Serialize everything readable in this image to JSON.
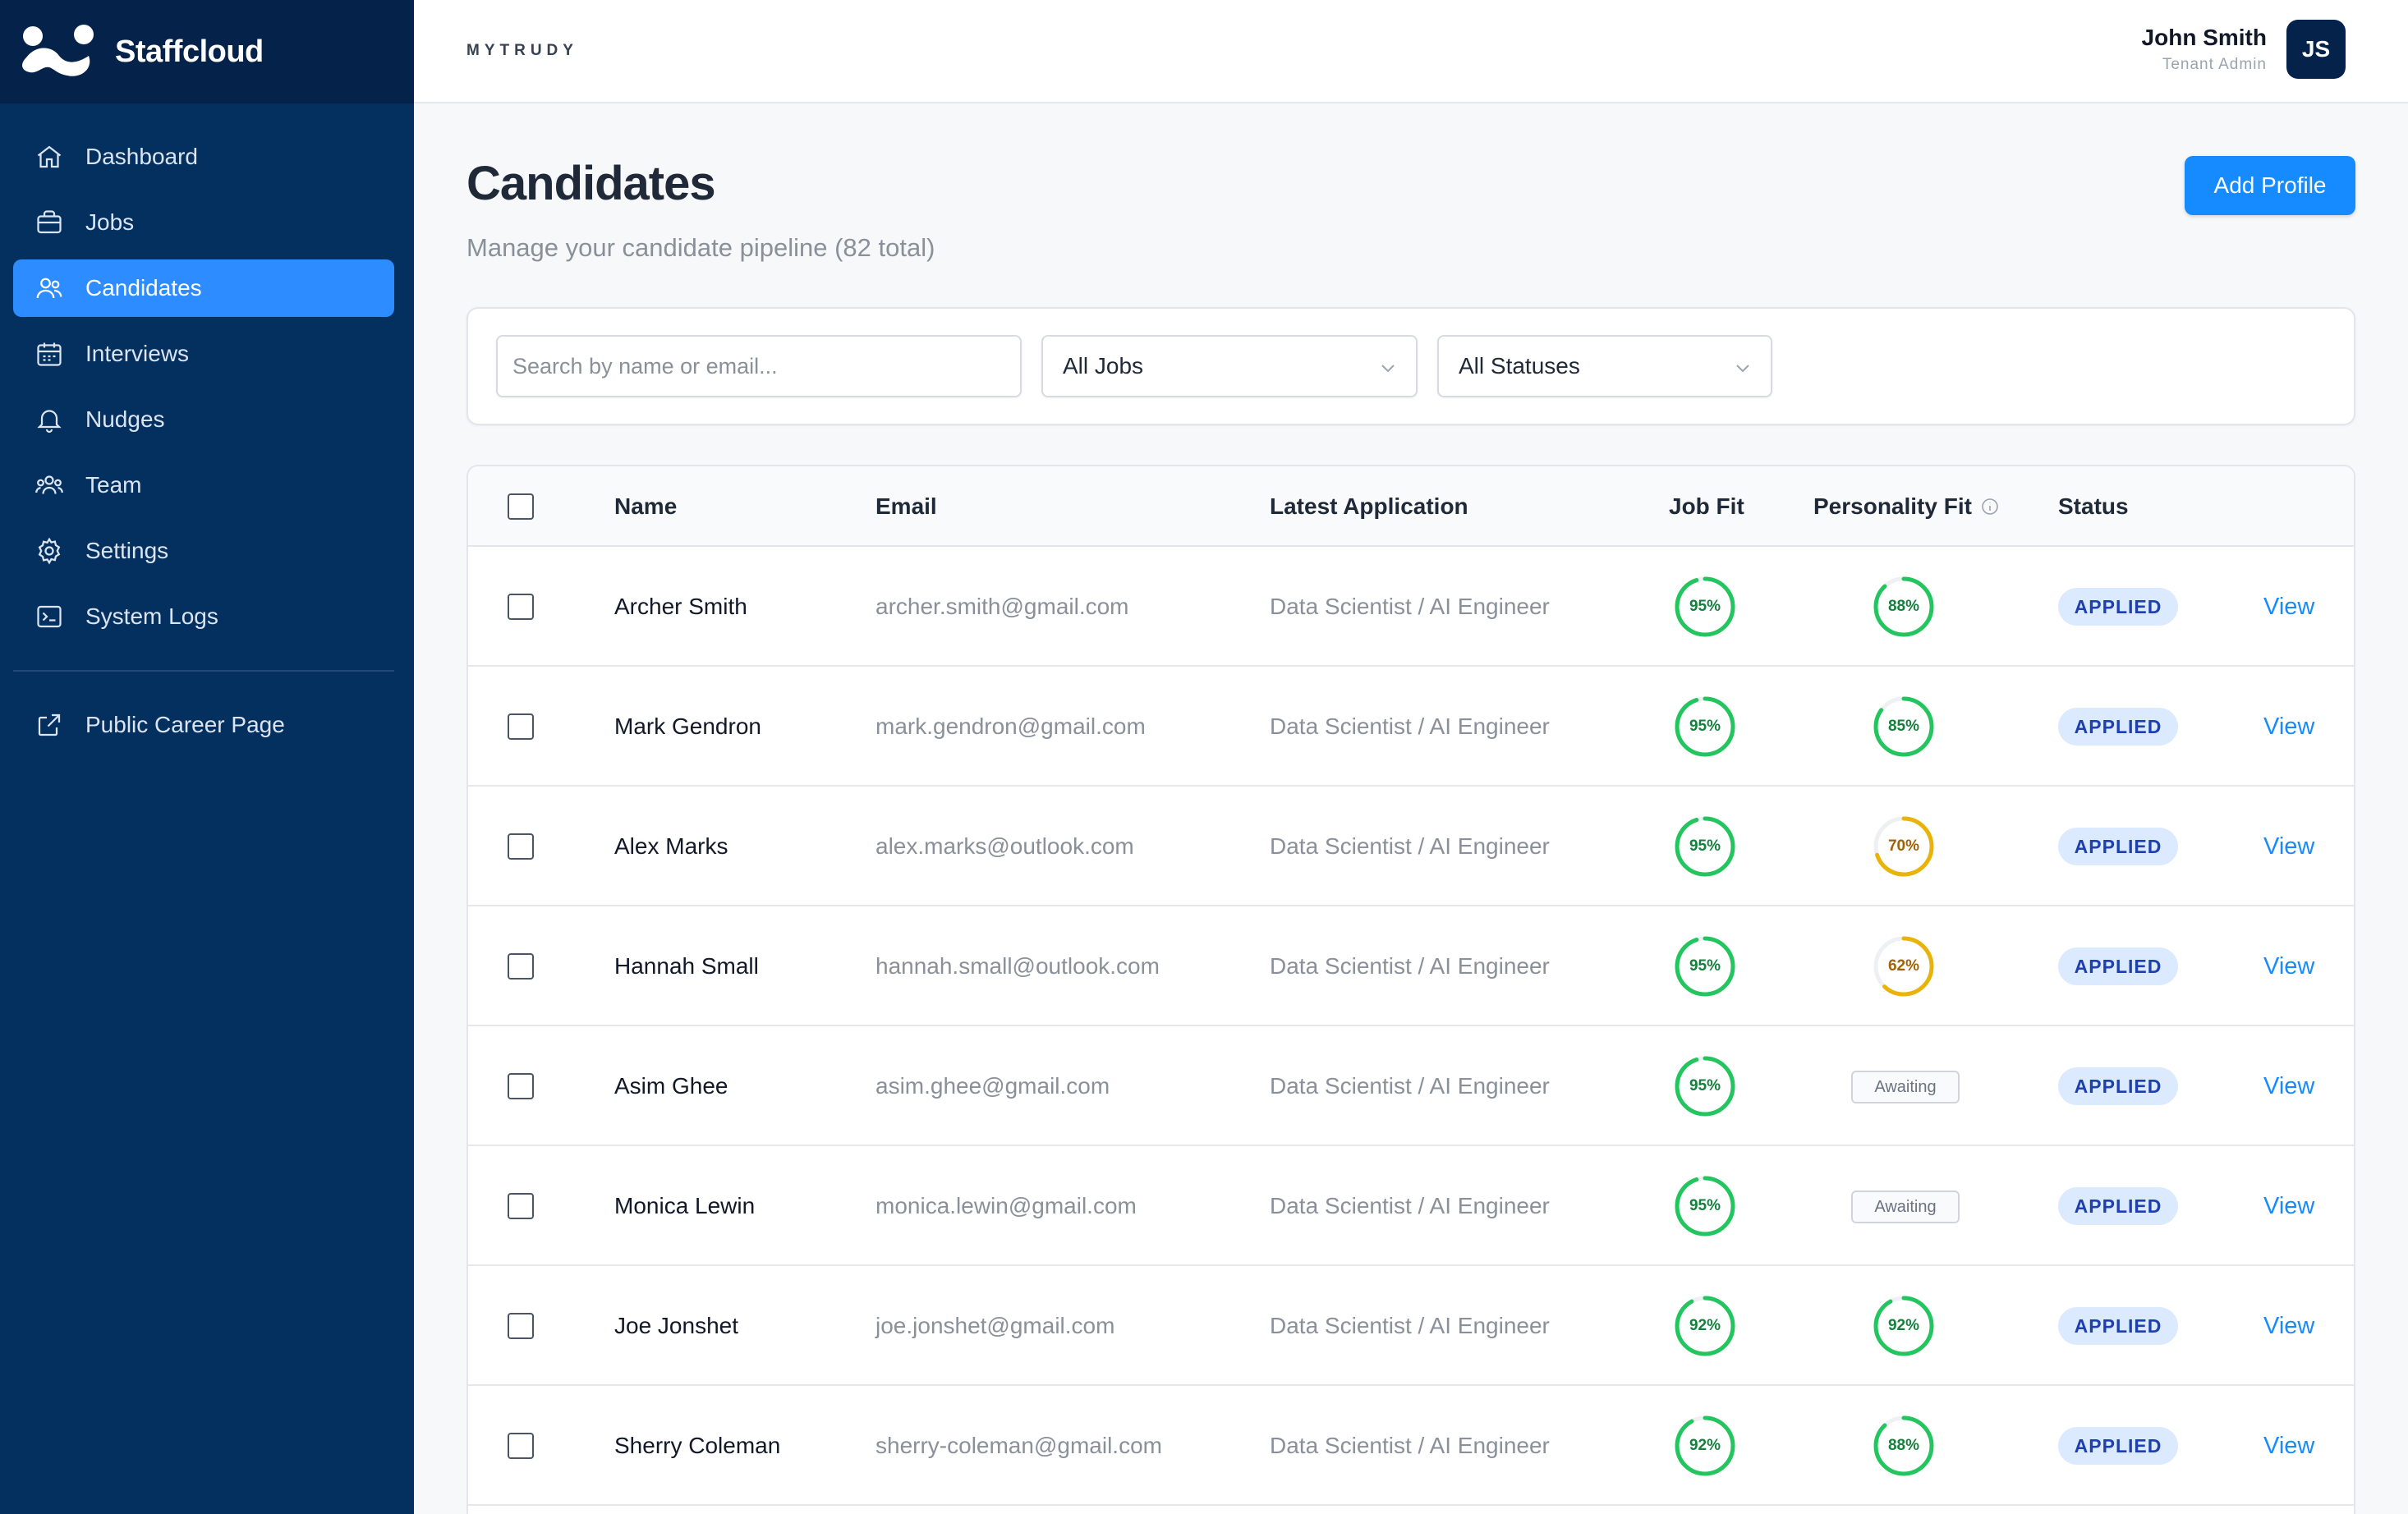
{
  "brand": {
    "name": "Staffcloud"
  },
  "sidebar": {
    "items": [
      {
        "label": "Dashboard",
        "icon": "home-icon"
      },
      {
        "label": "Jobs",
        "icon": "briefcase-icon"
      },
      {
        "label": "Candidates",
        "icon": "users-icon",
        "active": true
      },
      {
        "label": "Interviews",
        "icon": "calendar-icon"
      },
      {
        "label": "Nudges",
        "icon": "bell-icon"
      },
      {
        "label": "Team",
        "icon": "team-icon"
      },
      {
        "label": "Settings",
        "icon": "gear-icon"
      },
      {
        "label": "System Logs",
        "icon": "terminal-icon"
      }
    ],
    "footer_link": {
      "label": "Public Career Page",
      "icon": "external-link-icon"
    }
  },
  "header": {
    "tenant": "MYTRUDY",
    "user_name": "John Smith",
    "user_role": "Tenant Admin",
    "avatar_initials": "JS"
  },
  "page": {
    "title": "Candidates",
    "subtitle": "Manage your candidate pipeline (82 total)",
    "add_button": "Add Profile"
  },
  "filters": {
    "search_placeholder": "Search by name or email...",
    "jobs_selected": "All Jobs",
    "status_selected": "All Statuses"
  },
  "table": {
    "headers": {
      "name": "Name",
      "email": "Email",
      "latest_application": "Latest Application",
      "job_fit": "Job Fit",
      "personality_fit": "Personality Fit",
      "status": "Status"
    },
    "view_label": "View",
    "awaiting_label": "Awaiting",
    "rows": [
      {
        "name": "Archer Smith",
        "email": "archer.smith@gmail.com",
        "application": "Data Scientist / AI Engineer",
        "job_fit": 95,
        "job_fit_label": "95%",
        "personality_fit": 88,
        "personality_fit_label": "88%",
        "status": "APPLIED"
      },
      {
        "name": "Mark Gendron",
        "email": "mark.gendron@gmail.com",
        "application": "Data Scientist / AI Engineer",
        "job_fit": 95,
        "job_fit_label": "95%",
        "personality_fit": 85,
        "personality_fit_label": "85%",
        "status": "APPLIED"
      },
      {
        "name": "Alex Marks",
        "email": "alex.marks@outlook.com",
        "application": "Data Scientist / AI Engineer",
        "job_fit": 95,
        "job_fit_label": "95%",
        "personality_fit": 70,
        "personality_fit_label": "70%",
        "status": "APPLIED"
      },
      {
        "name": "Hannah Small",
        "email": "hannah.small@outlook.com",
        "application": "Data Scientist / AI Engineer",
        "job_fit": 95,
        "job_fit_label": "95%",
        "personality_fit": 62,
        "personality_fit_label": "62%",
        "status": "APPLIED"
      },
      {
        "name": "Asim Ghee",
        "email": "asim.ghee@gmail.com",
        "application": "Data Scientist / AI Engineer",
        "job_fit": 95,
        "job_fit_label": "95%",
        "personality_fit": null,
        "personality_fit_label": "Awaiting",
        "status": "APPLIED"
      },
      {
        "name": "Monica Lewin",
        "email": "monica.lewin@gmail.com",
        "application": "Data Scientist / AI Engineer",
        "job_fit": 95,
        "job_fit_label": "95%",
        "personality_fit": null,
        "personality_fit_label": "Awaiting",
        "status": "APPLIED"
      },
      {
        "name": "Joe Jonshet",
        "email": "joe.jonshet@gmail.com",
        "application": "Data Scientist / AI Engineer",
        "job_fit": 92,
        "job_fit_label": "92%",
        "personality_fit": 92,
        "personality_fit_label": "92%",
        "status": "APPLIED"
      },
      {
        "name": "Sherry Coleman",
        "email": "sherry-coleman@gmail.com",
        "application": "Data Scientist / AI Engineer",
        "job_fit": 92,
        "job_fit_label": "92%",
        "personality_fit": 88,
        "personality_fit_label": "88%",
        "status": "APPLIED"
      }
    ]
  },
  "colors": {
    "sidebar_bg": "#03305f",
    "brand_bg": "#05234a",
    "accent": "#168bff",
    "fit_high": "#22c55e",
    "fit_high_text": "#15803d",
    "fit_mid": "#eab308",
    "fit_mid_text": "#a16207",
    "badge_bg": "#dbeafe",
    "badge_text": "#1e40af"
  }
}
